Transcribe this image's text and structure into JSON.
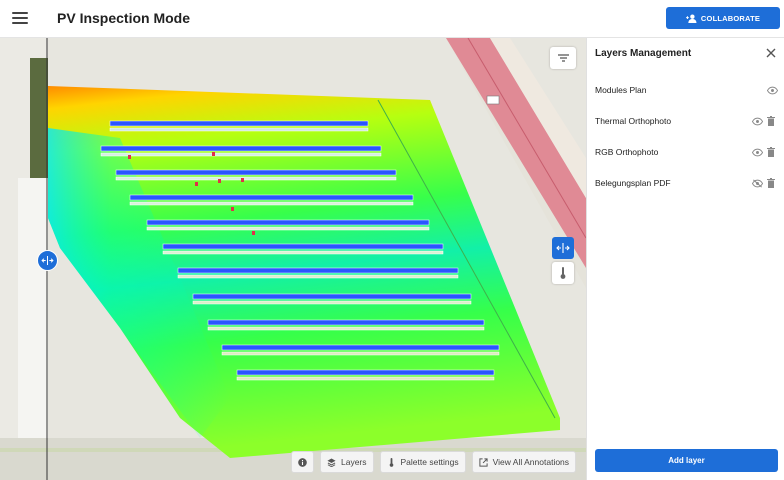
{
  "header": {
    "title": "PV Inspection Mode",
    "collaborate_label": "COLLABORATE"
  },
  "map": {
    "toolbar": {
      "info_label": "",
      "layers_label": "Layers",
      "palette_label": "Palette settings",
      "annotations_label": "View All Annotations"
    },
    "thermal_colors": [
      "#ff7a00",
      "#ffd000",
      "#b8ff00",
      "#33ff33",
      "#00ffb0",
      "#00d0ff",
      "#1e44ff"
    ]
  },
  "layers_panel": {
    "title": "Layers Management",
    "layers": [
      {
        "label": "Modules Plan",
        "visible": true,
        "deletable": false
      },
      {
        "label": "Thermal Orthophoto",
        "visible": true,
        "deletable": true
      },
      {
        "label": "RGB Orthophoto",
        "visible": true,
        "deletable": true
      },
      {
        "label": "Belegungsplan PDF",
        "visible": false,
        "deletable": true
      }
    ],
    "add_label": "Add layer"
  },
  "colors": {
    "accent": "#1e6ed8",
    "road": "#e08a95"
  }
}
